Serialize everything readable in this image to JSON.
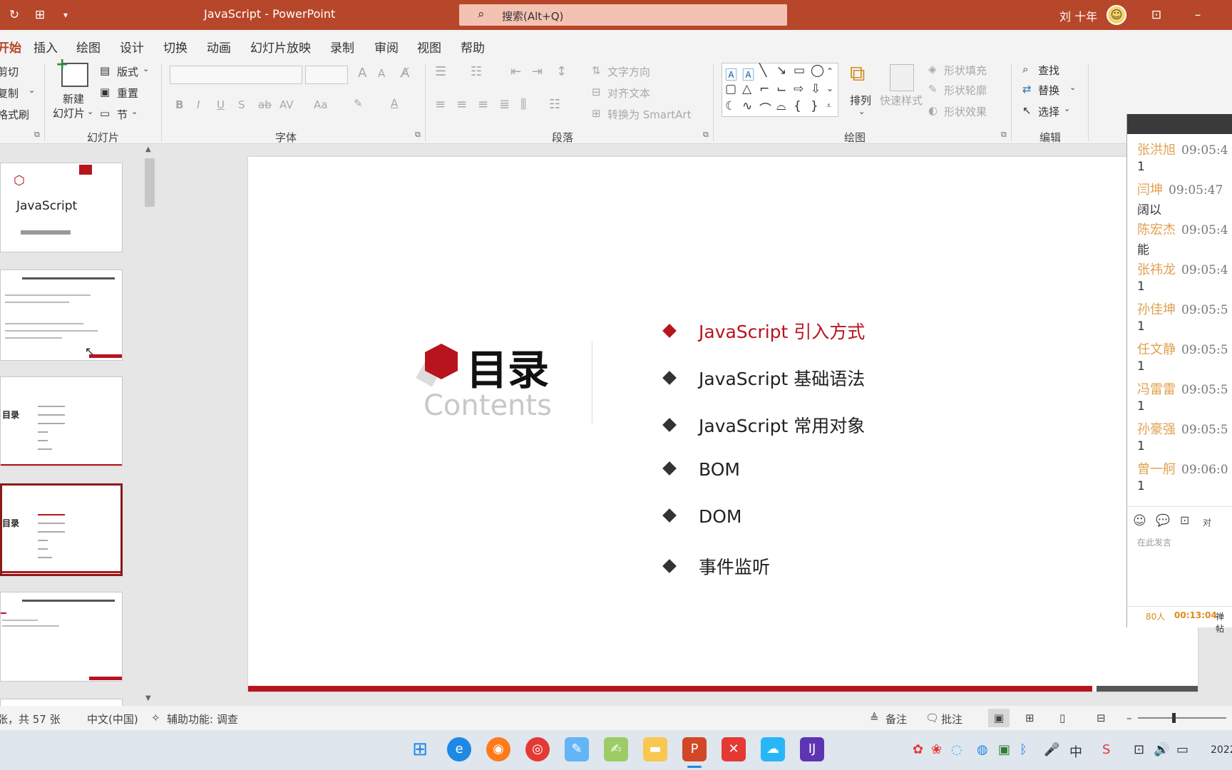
{
  "titlebar": {
    "title": "JavaScript  -  PowerPoint",
    "search_placeholder": "搜索(Alt+Q)",
    "user": "刘 十年"
  },
  "menu": [
    "开始",
    "插入",
    "绘图",
    "设计",
    "切换",
    "动画",
    "幻灯片放映",
    "录制",
    "审阅",
    "视图",
    "帮助"
  ],
  "ribbon": {
    "clipboard": {
      "cut": "剪切",
      "copy": "复制",
      "format_painter": "格式刷"
    },
    "slides": {
      "new_slide_line1": "新建",
      "new_slide_line2": "幻灯片",
      "layout": "版式",
      "reset": "重置",
      "section": "节",
      "group": "幻灯片"
    },
    "font": {
      "group": "字体",
      "bold": "B",
      "italic": "I",
      "underline": "U",
      "shadow": "S",
      "strike": "ab",
      "spacing": "AV",
      "case": "Aa",
      "grow": "A",
      "shrink": "A",
      "color": "A"
    },
    "paragraph": {
      "group": "段落",
      "text_direction": "文字方向",
      "align_text": "对齐文本",
      "smartart": "转换为 SmartArt"
    },
    "drawing": {
      "group": "绘图",
      "arrange": "排列",
      "quick_styles": "快速样式",
      "shape_fill": "形状填充",
      "shape_outline": "形状轮廓",
      "shape_effects": "形状效果"
    },
    "editing": {
      "group": "编辑",
      "find": "查找",
      "replace": "替换",
      "select": "选择"
    }
  },
  "thumbnails": [
    {
      "title": "JavaScript"
    },
    {
      "title": ""
    },
    {
      "title": "目录"
    },
    {
      "title": "目录"
    },
    {
      "title": ""
    }
  ],
  "slide": {
    "title": "目录",
    "subtitle": "Contents",
    "items": [
      "JavaScript 引入方式",
      "JavaScript 基础语法",
      "JavaScript 常用对象",
      "BOM",
      "DOM",
      "事件监听"
    ]
  },
  "chat": {
    "messages": [
      {
        "name": "张洪旭",
        "time": "09:05:4",
        "body": "1"
      },
      {
        "name": "闫坤",
        "time": "09:05:47",
        "body": "阔以"
      },
      {
        "name": "陈宏杰",
        "time": "09:05:4",
        "body": "能"
      },
      {
        "name": "张祎龙",
        "time": "09:05:4",
        "body": "1"
      },
      {
        "name": "孙佳坤",
        "time": "09:05:5",
        "body": "1"
      },
      {
        "name": "任文静",
        "time": "09:05:5",
        "body": "1"
      },
      {
        "name": "冯雷雷",
        "time": "09:05:5",
        "body": "1"
      },
      {
        "name": "孙豪强",
        "time": "09:05:5",
        "body": "1"
      },
      {
        "name": "曾一舸",
        "time": "09:06:0",
        "body": "1"
      }
    ],
    "input_placeholder": "在此发言",
    "to_label": "对",
    "people": "80人",
    "duration": "00:13:04",
    "extra": "禅帖"
  },
  "status": {
    "slide_info": "张，共 57 张",
    "language": "中文(中国)",
    "accessibility": "辅助功能: 调查",
    "notes": "备注",
    "comments": "批注",
    "clock": "2022"
  },
  "colors": {
    "accent": "#b7472a",
    "slide_red": "#b7141e"
  }
}
